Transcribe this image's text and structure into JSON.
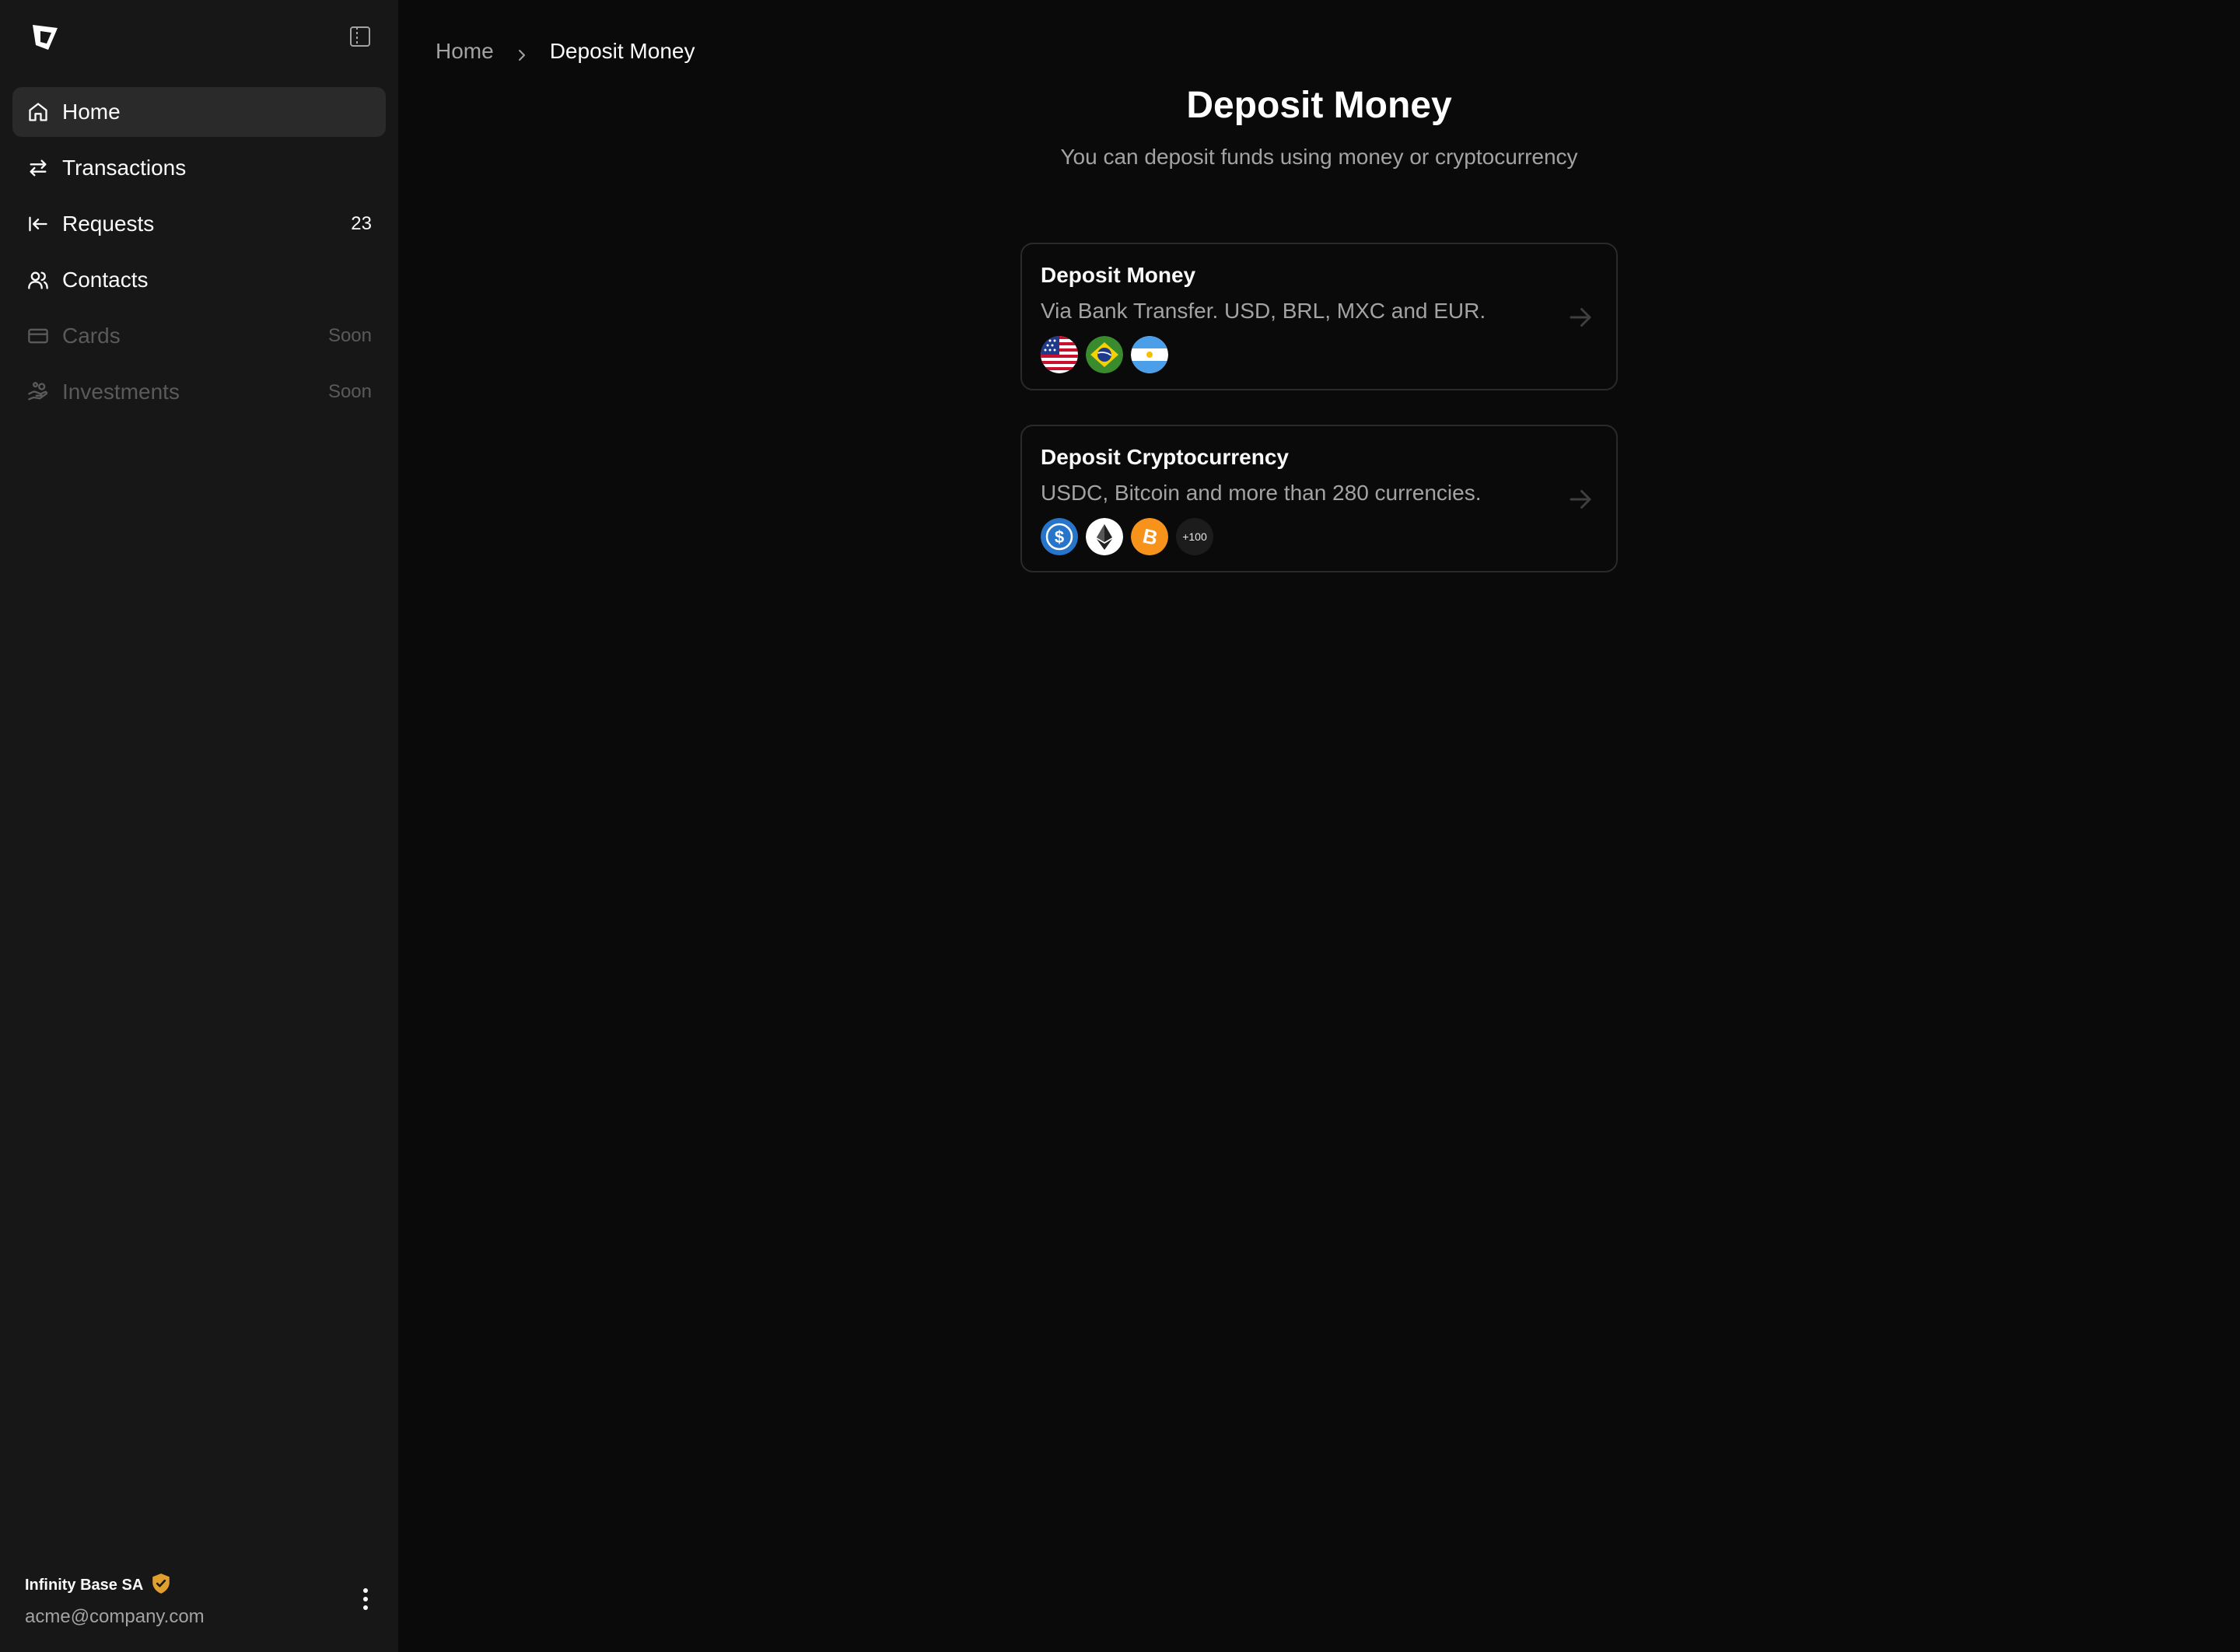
{
  "sidebar": {
    "items": [
      {
        "label": "Home",
        "icon": "home-icon",
        "active": true
      },
      {
        "label": "Transactions",
        "icon": "arrows-swap-icon"
      },
      {
        "label": "Requests",
        "icon": "arrow-left-to-line-icon",
        "count": "23"
      },
      {
        "label": "Contacts",
        "icon": "users-icon"
      },
      {
        "label": "Cards",
        "icon": "credit-card-icon",
        "badge": "Soon",
        "disabled": true
      },
      {
        "label": "Investments",
        "icon": "hand-coins-icon",
        "badge": "Soon",
        "disabled": true
      }
    ],
    "profile": {
      "org": "Infinity Base SA",
      "email": "acme@company.com",
      "verified_color": "#e0a030"
    }
  },
  "breadcrumb": {
    "home": "Home",
    "current": "Deposit Money"
  },
  "main": {
    "title": "Deposit Money",
    "subtitle": "You can deposit funds using money or cryptocurrency",
    "cards": [
      {
        "title": "Deposit Money",
        "description": "Via Bank Transfer. USD, BRL, MXC and EUR.",
        "badges": [
          "us-flag-icon",
          "brazil-flag-icon",
          "argentina-flag-icon"
        ]
      },
      {
        "title": "Deposit Cryptocurrency",
        "description": "USDC, Bitcoin and more than 280 currencies.",
        "badges": [
          "usdc-icon",
          "ethereum-icon",
          "bitcoin-icon"
        ],
        "more_label": "+100"
      }
    ]
  },
  "colors": {
    "background": "#0a0a0a",
    "sidebar": "#171717",
    "active_item": "#2a2a2a",
    "card_border": "#2a2a2a",
    "usdc": "#2775ca",
    "bitcoin": "#f7931a"
  }
}
